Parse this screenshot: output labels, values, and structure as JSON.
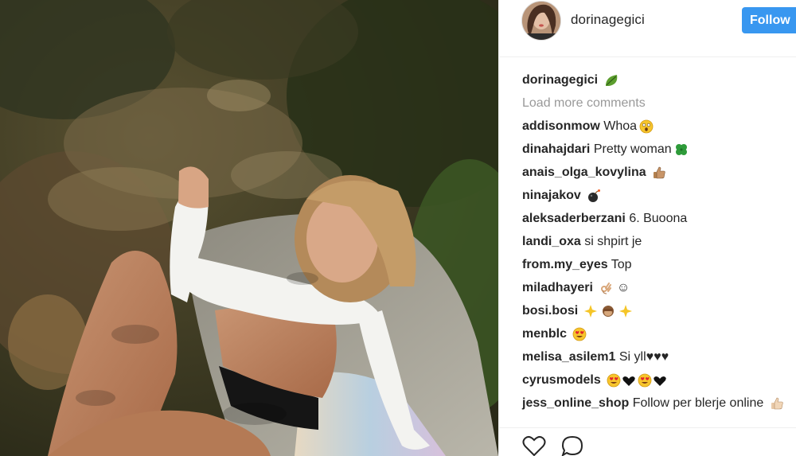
{
  "post": {
    "photo_icon": "photo-woman-sunbathing",
    "author": {
      "username": "dorinagegici",
      "avatar_icon": "avatar-photo"
    },
    "follow_label": "Follow",
    "caption": {
      "username": "dorinagegici",
      "emoji_icon": "leaf-emoji"
    },
    "load_more_label": "Load more comments",
    "comments": [
      {
        "username": "addisonmow",
        "text": "Whoa",
        "emoji": "astonished-face-emoji"
      },
      {
        "username": "dinahajdari",
        "text": "Pretty woman",
        "emoji": "four-leaf-clover-emoji"
      },
      {
        "username": "anais_olga_kovylina",
        "text": "",
        "emoji": "thumbs-up-emoji"
      },
      {
        "username": "ninajakov",
        "text": "",
        "emoji": "bomb-emoji"
      },
      {
        "username": "aleksaderberzani",
        "text": "6. Buoona",
        "emoji": ""
      },
      {
        "username": "landi_oxa",
        "text": "si shpirt je",
        "emoji": ""
      },
      {
        "username": "from.my_eyes",
        "text": "Top",
        "emoji": ""
      },
      {
        "username": "miladhayeri",
        "text": "☺",
        "emoji": "ok-hand-emoji"
      },
      {
        "username": "bosi.bosi",
        "text": "",
        "emoji": "sparkles-monkey-sparkles-emoji"
      },
      {
        "username": "menblc",
        "text": "",
        "emoji": "heart-eyes-emoji"
      },
      {
        "username": "melisa_asilem1",
        "text": "Si yll♥♥♥",
        "emoji": ""
      },
      {
        "username": "cyrusmodels",
        "text": "",
        "emoji": "heart-eyes-black-hearts-emoji"
      },
      {
        "username": "jess_online_shop",
        "text": "Follow per blerje online",
        "emoji": "thumbs-up-emoji"
      }
    ],
    "actions": {
      "like_icon": "heart-outline-icon",
      "comment_icon": "speech-bubble-icon"
    }
  },
  "colors": {
    "follow_bg": "#3897f0",
    "text": "#262626",
    "muted": "#999999"
  }
}
